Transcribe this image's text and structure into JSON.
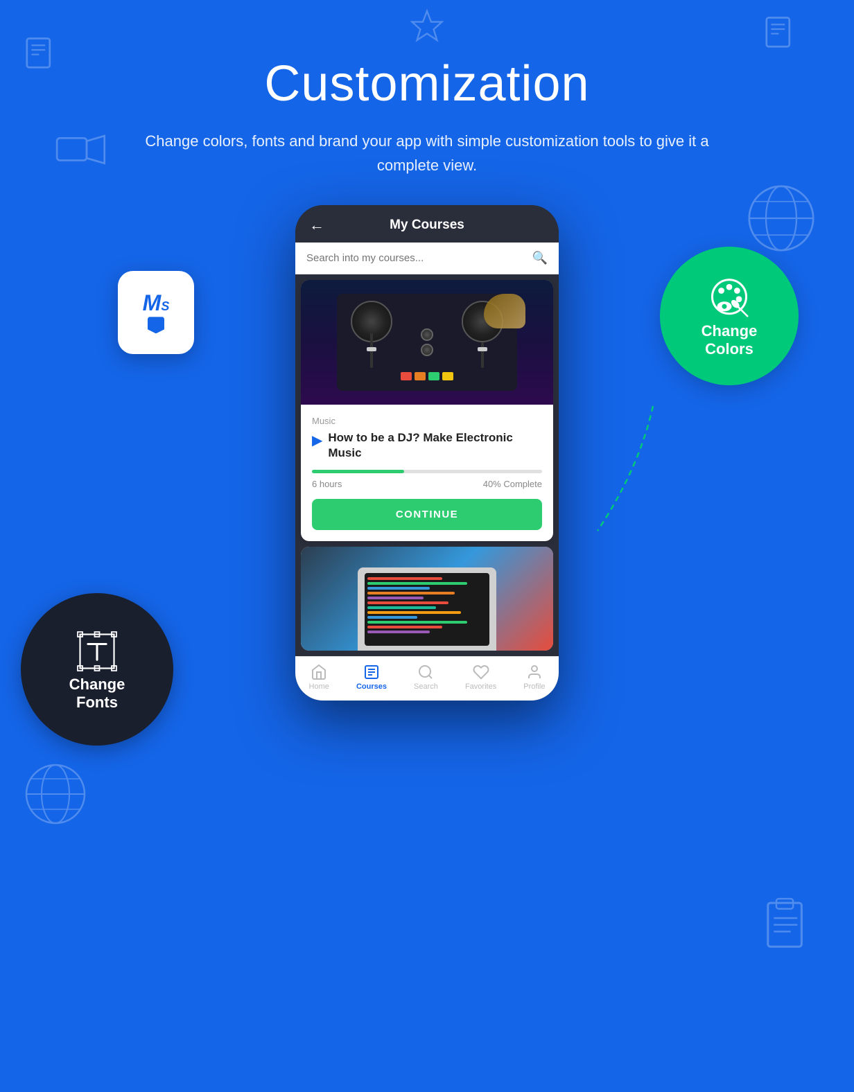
{
  "page": {
    "background_color": "#1565E8",
    "title": "Customization",
    "subtitle": "Change colors, fonts and brand your app with simple customization tools to give it a complete view."
  },
  "app_icon": {
    "letter1": "M",
    "letter2": "S",
    "alt": "MS App Icon"
  },
  "phone": {
    "header": {
      "back_label": "←",
      "title": "My Courses"
    },
    "search": {
      "placeholder": "Search into my courses..."
    },
    "course1": {
      "category": "Music",
      "name": "How to be a DJ? Make Electronic Music",
      "duration": "6 hours",
      "progress_label": "40% Complete",
      "progress_pct": 40,
      "continue_label": "CONTINUE"
    },
    "bottom_nav": {
      "items": [
        {
          "label": "Home",
          "icon": "⌂",
          "active": false
        },
        {
          "label": "Courses",
          "icon": "☰",
          "active": true
        },
        {
          "label": "Search",
          "icon": "⌕",
          "active": false
        },
        {
          "label": "Favorites",
          "icon": "♡",
          "active": false
        },
        {
          "label": "Profile",
          "icon": "👤",
          "active": false
        }
      ]
    }
  },
  "change_colors": {
    "title_line1": "Change",
    "title_line2": "Colors",
    "circle_color": "#00C97A"
  },
  "change_fonts": {
    "title_line1": "Change",
    "title_line2": "Fonts",
    "circle_color": "#1a1f2e"
  }
}
